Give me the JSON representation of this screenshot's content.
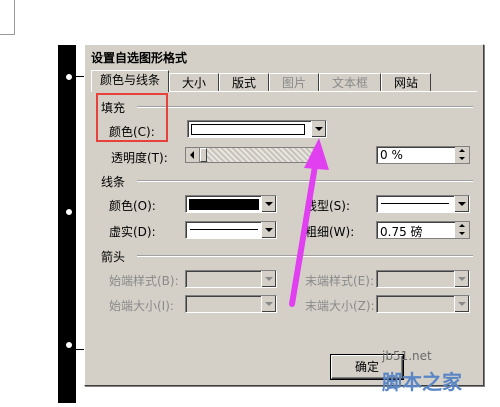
{
  "dialog": {
    "title": "设置自选图形格式"
  },
  "tabs": [
    {
      "label": "颜色与线条",
      "state": "active"
    },
    {
      "label": "大小",
      "state": "normal"
    },
    {
      "label": "版式",
      "state": "normal"
    },
    {
      "label": "图片",
      "state": "disabled"
    },
    {
      "label": "文本框",
      "state": "disabled"
    },
    {
      "label": "网站",
      "state": "normal"
    }
  ],
  "fill": {
    "section_label": "填充",
    "color_label": "颜色(C):",
    "color_value": "#ffffff",
    "transparency_label": "透明度(T):",
    "transparency_value": "0 %"
  },
  "line": {
    "section_label": "线条",
    "color_label": "颜色(O):",
    "color_value": "#000000",
    "dash_label": "虚实(D):",
    "style_label": "线型(S):",
    "weight_label": "粗细(W):",
    "weight_value": "0.75 磅"
  },
  "arrows": {
    "section_label": "箭头",
    "begin_style_label": "始端样式(B):",
    "end_style_label": "末端样式(E):",
    "begin_size_label": "始端大小(I):",
    "end_size_label": "末端大小(Z):"
  },
  "buttons": {
    "ok_label": "确定"
  },
  "annotation": {
    "highlight_color": "#e8403a",
    "arrow_color": "#e040f0"
  },
  "watermark": {
    "url": "jb51.net",
    "brand": "脚本之家"
  }
}
